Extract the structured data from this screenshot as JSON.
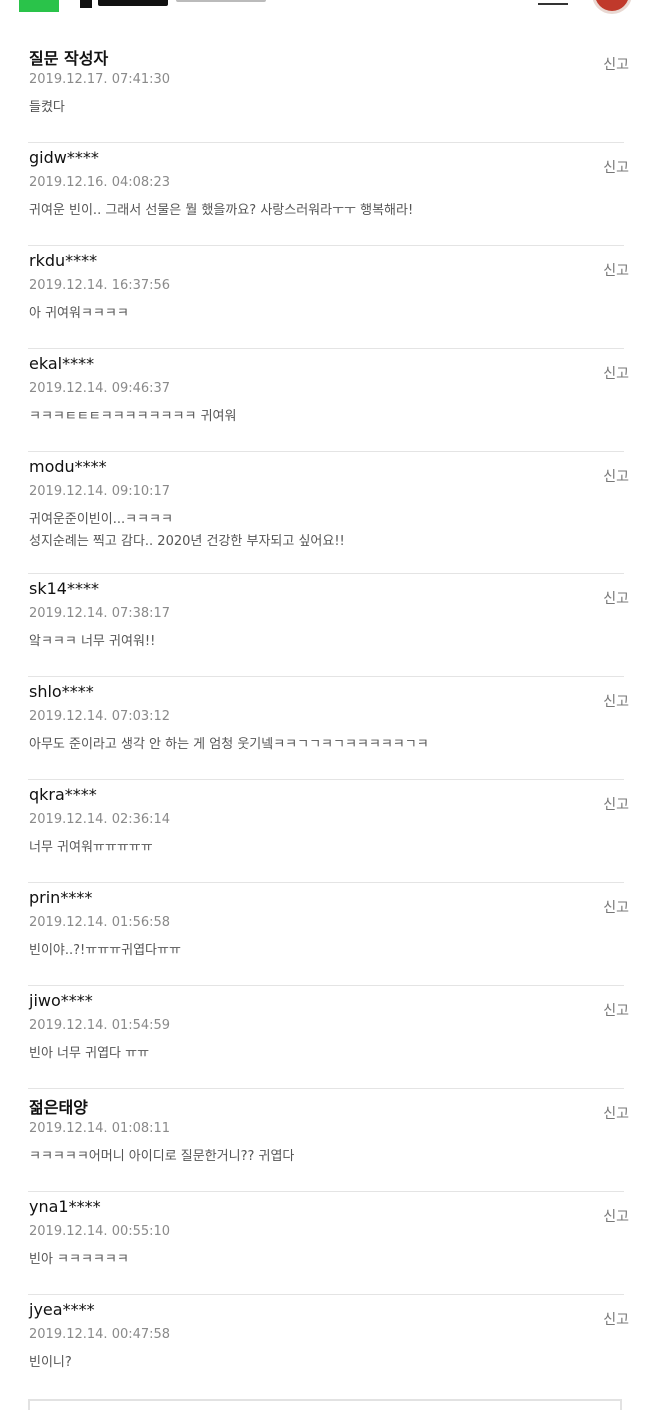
{
  "report_label": "신고",
  "comments": [
    {
      "author": "질문 작성자",
      "time": "2019.12.17. 07:41:30",
      "text": "들켰다"
    },
    {
      "author": "gidw****",
      "time": "2019.12.16. 04:08:23",
      "text": "귀여운 빈이.. 그래서 선물은 뭘 했을까요? 사랑스러워라ㅜㅜ 행복해라!"
    },
    {
      "author": "rkdu****",
      "time": "2019.12.14. 16:37:56",
      "text": "아 귀여워ㅋㅋㅋㅋ"
    },
    {
      "author": "ekal****",
      "time": "2019.12.14. 09:46:37",
      "text": "ㅋㅋㅋㅌㅌㅌㅋㅋㅋㅋㅋㅋㅋㅋ 귀여워"
    },
    {
      "author": "modu****",
      "time": "2019.12.14. 09:10:17",
      "text": "귀여운준이빈이...ㅋㅋㅋㅋ\n성지순례는 찍고 감다.. 2020년 건강한 부자되고 싶어요!!"
    },
    {
      "author": "sk14****",
      "time": "2019.12.14. 07:38:17",
      "text": "앜ㅋㅋㅋ 너무 귀여워!!"
    },
    {
      "author": "shlo****",
      "time": "2019.12.14. 07:03:12",
      "text": "아무도 준이라고 생각 안 하는 게 엄청 웃기넼ㅋㅋㄱㄱㅋㄱㅋㅋㅋㅋㅋㄱㅋ"
    },
    {
      "author": "qkra****",
      "time": "2019.12.14. 02:36:14",
      "text": "너무 귀여워ㅠㅠㅠㅠㅠ"
    },
    {
      "author": "prin****",
      "time": "2019.12.14. 01:56:58",
      "text": "빈이야..?!ㅠㅠㅠ귀엽다ㅠㅠ"
    },
    {
      "author": "jiwo****",
      "time": "2019.12.14. 01:54:59",
      "text": "빈아 너무 귀엽다 ㅠㅠ"
    },
    {
      "author": "젊은태양",
      "time": "2019.12.14. 01:08:11",
      "text": "ㅋㅋㅋㅋㅋ어머니 아이디로 질문한거니?? 귀엽다"
    },
    {
      "author": "yna1****",
      "time": "2019.12.14. 00:55:10",
      "text": "빈아 ㅋㅋㅋㅋㅋㅋ"
    },
    {
      "author": "jyea****",
      "time": "2019.12.14. 00:47:58",
      "text": "빈이니?"
    }
  ]
}
